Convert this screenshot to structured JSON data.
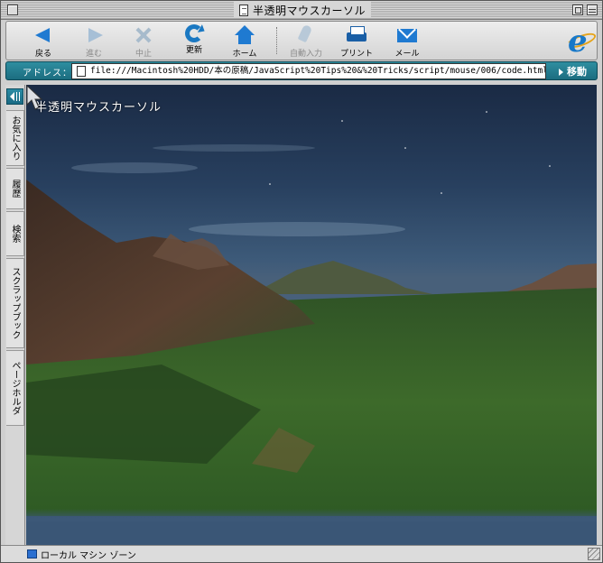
{
  "window": {
    "title": "半透明マウスカーソル"
  },
  "toolbar": {
    "buttons": [
      {
        "label": "戻る",
        "icon": "back-arrow-icon",
        "enabled": true
      },
      {
        "label": "進む",
        "icon": "forward-arrow-icon",
        "enabled": false
      },
      {
        "label": "中止",
        "icon": "stop-icon",
        "enabled": false
      },
      {
        "label": "更新",
        "icon": "refresh-icon",
        "enabled": true
      },
      {
        "label": "ホーム",
        "icon": "home-icon",
        "enabled": true
      },
      {
        "label": "自動入力",
        "icon": "autofill-icon",
        "enabled": false
      },
      {
        "label": "プリント",
        "icon": "print-icon",
        "enabled": true
      },
      {
        "label": "メール",
        "icon": "mail-icon",
        "enabled": true
      }
    ]
  },
  "address": {
    "label": "アドレス：",
    "url": "file:///Macintosh%20HDD/本の原稿/JavaScript%20Tips%20&%20Tricks/script/mouse/006/code.html",
    "go_label": "移動"
  },
  "sidebar": {
    "tabs": [
      "お気に入り",
      "履歴",
      "検索",
      "スクラップブック",
      "ページホルダ"
    ]
  },
  "page": {
    "heading": "半透明マウスカーソル"
  },
  "status": {
    "zone": "ローカル マシン ゾーン"
  },
  "colors": {
    "accent": "#1f7ad1",
    "address_bar": "#1c6d80",
    "logo_ring": "#e5a31a"
  }
}
